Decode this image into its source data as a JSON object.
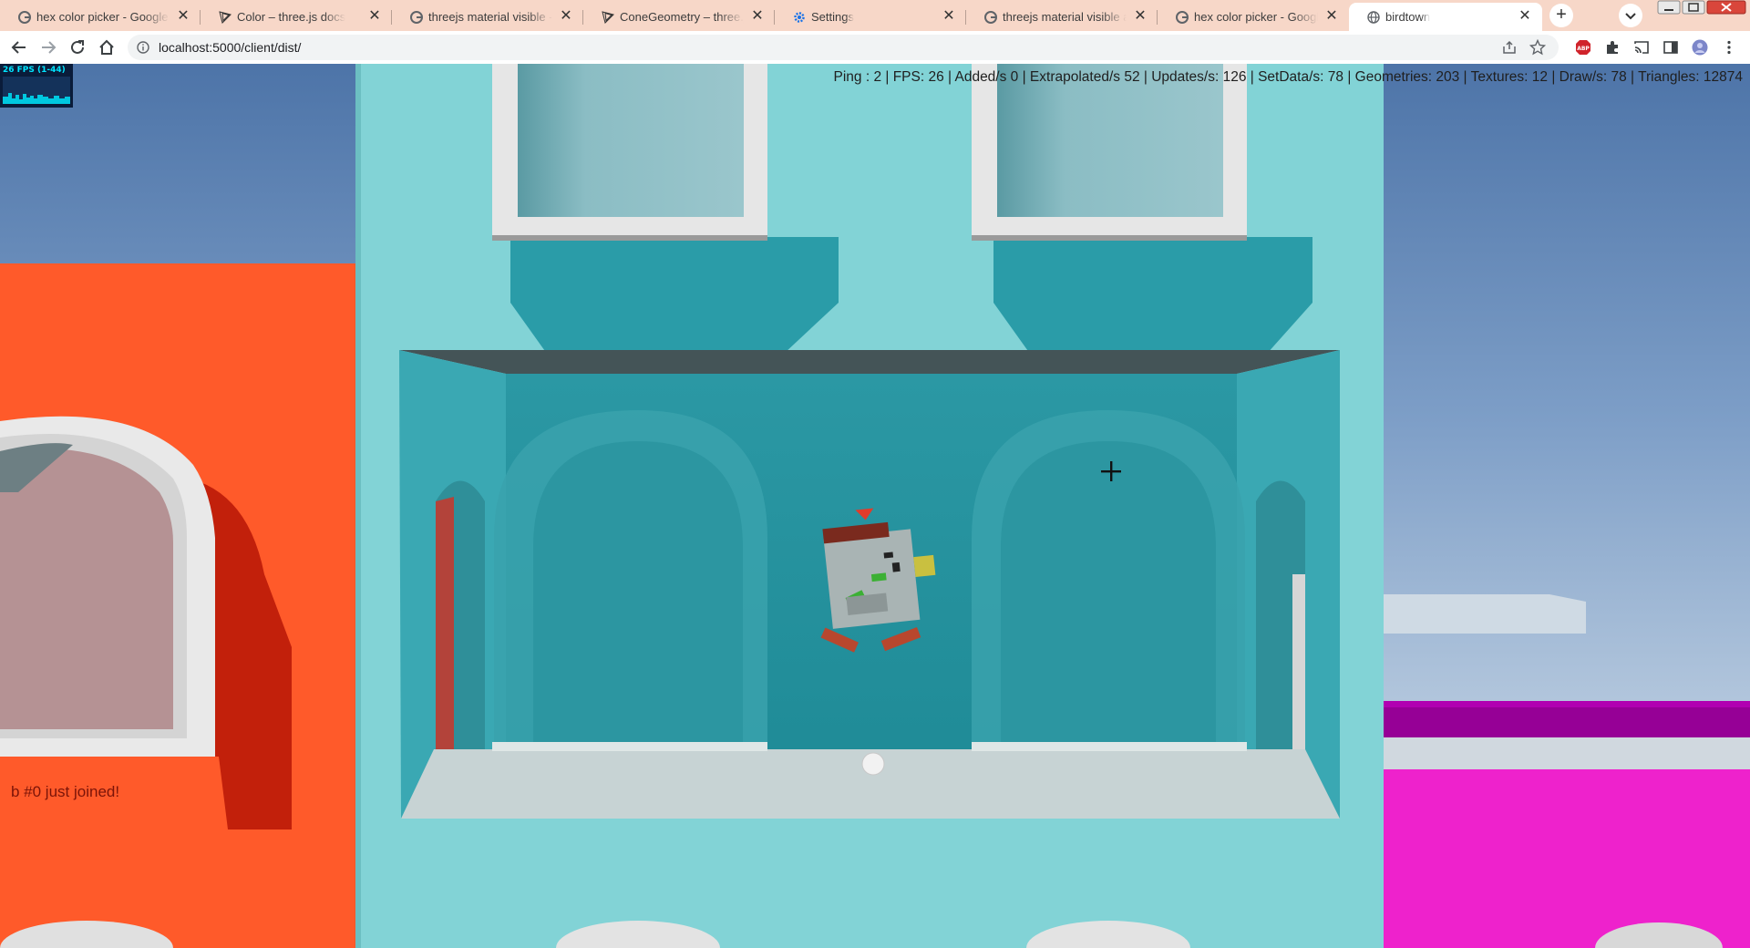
{
  "browser": {
    "tabs": [
      {
        "label": "hex color picker - Google Search",
        "icon": "google-icon",
        "active": false
      },
      {
        "label": "Color – three.js docs",
        "icon": "threejs-icon",
        "active": false
      },
      {
        "label": "threejs material visible - Google Search",
        "icon": "google-icon",
        "active": false
      },
      {
        "label": "ConeGeometry – three.js docs",
        "icon": "threejs-icon",
        "active": false
      },
      {
        "label": "Settings",
        "icon": "gear-icon",
        "active": false
      },
      {
        "label": "threejs material visible affects",
        "icon": "google-icon",
        "active": false
      },
      {
        "label": "hex color picker - Google Search",
        "icon": "google-icon",
        "active": false
      },
      {
        "label": "birdtown",
        "icon": "globe-icon",
        "active": true
      }
    ],
    "close_glyph": "✕",
    "new_tab_glyph": "+",
    "url": "localhost:5000/client/dist/",
    "colors": {
      "tab_strip": "#f7d7c8",
      "omnibox": "#f1f3f4"
    }
  },
  "game": {
    "hud_stats": "Ping : 2 | FPS: 26 | Added/s 0 | Extrapolated/s 52 | Updates/s: 126 | SetData/s: 78 | Geometries: 203 | Textures: 12 | Draw/s: 78 | Triangles: 12874",
    "fps_panel": "26 FPS (1-44)",
    "chat_message": "b #0 just joined!",
    "colors": {
      "sky": "#5a7fb0",
      "building_teal": "#82d3d6",
      "recess_teal": "#2a9aa6",
      "building_orange": "#ff5a2a",
      "building_magenta": "#ee22cc",
      "trim_white": "#e8e8e8",
      "bird_body": "#a9b4b4",
      "bird_marker": "#e23b2a"
    }
  }
}
